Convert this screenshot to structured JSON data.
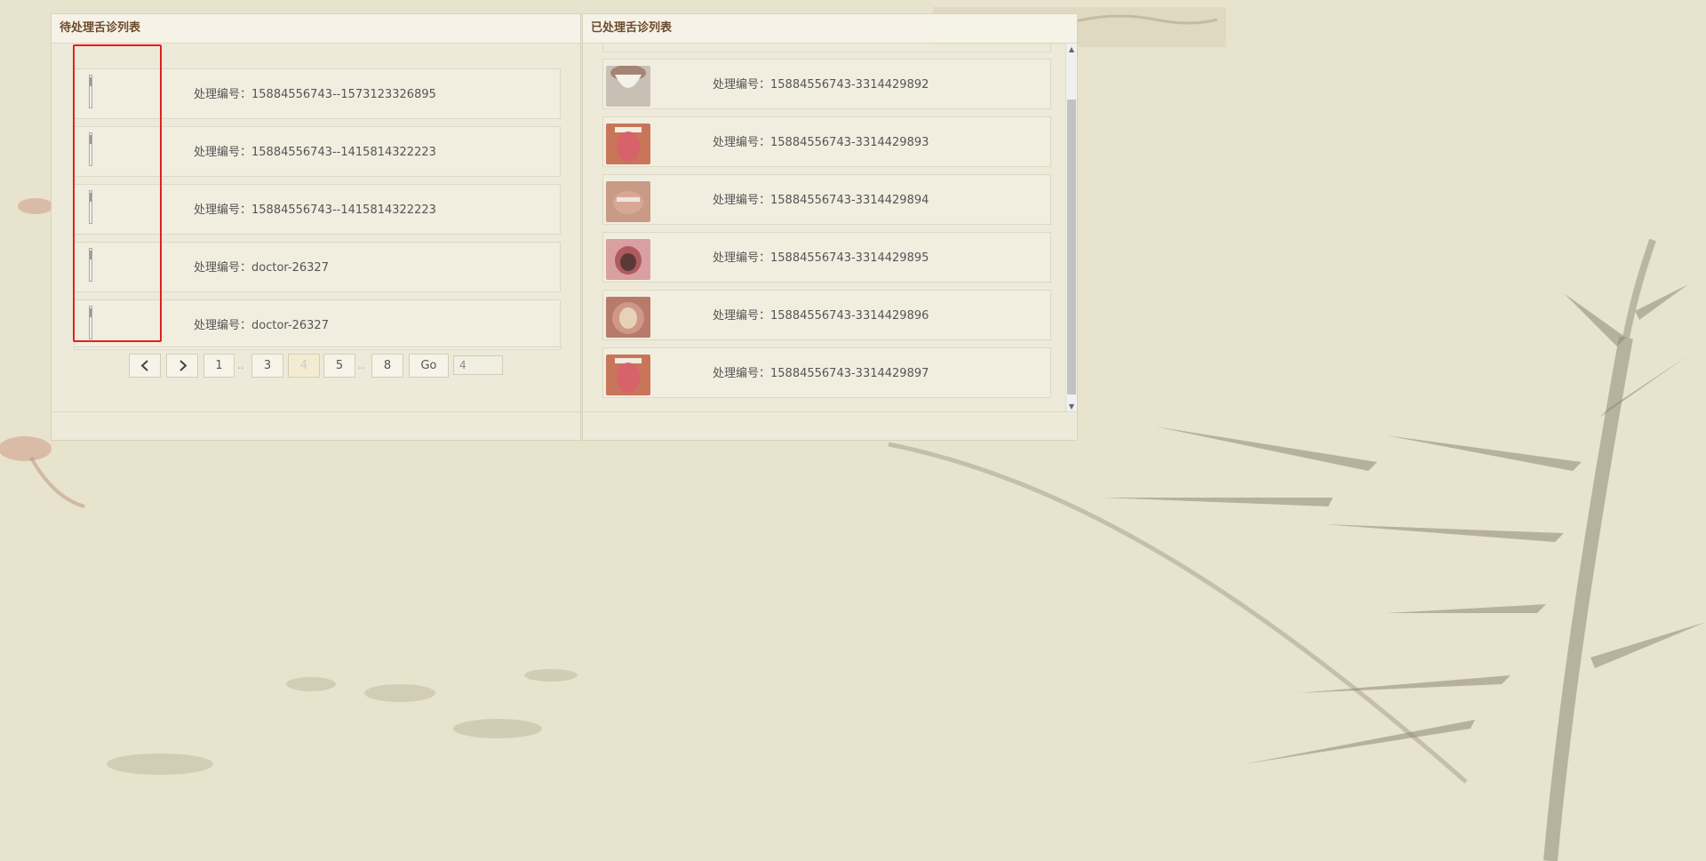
{
  "pending_panel": {
    "title": "待处理舌诊列表",
    "items": [
      {
        "label": "处理编号：15884556743--1573123326895"
      },
      {
        "label": "处理编号：15884556743--1415814322223"
      },
      {
        "label": "处理编号：15884556743--1415814322223"
      },
      {
        "label": "处理编号：doctor-26327"
      },
      {
        "label": "处理编号：doctor-26327"
      }
    ],
    "pagination": {
      "prev_icon": "chevron-left-icon",
      "next_icon": "chevron-right-icon",
      "pages": [
        "1",
        "3",
        "4",
        "5",
        "8"
      ],
      "current_page": "4",
      "ellipsis": "..",
      "go_label": "Go",
      "jump_value": "4"
    }
  },
  "processed_panel": {
    "title": "已处理舌诊列表",
    "items": [
      {
        "label": "处理编号：15884556743-3314429892"
      },
      {
        "label": "处理编号：15884556743-3314429893"
      },
      {
        "label": "处理编号：15884556743-3314429894"
      },
      {
        "label": "处理编号：15884556743-3314429895"
      },
      {
        "label": "处理编号：15884556743-3314429896"
      },
      {
        "label": "处理编号：15884556743-3314429897"
      }
    ],
    "scrollbar": {
      "up_icon": "arrow-up-icon",
      "down_icon": "arrow-down-icon"
    }
  },
  "colors": {
    "highlight": "#e02020",
    "header_text": "#6b4a2c",
    "background": "#e8e3cc"
  }
}
